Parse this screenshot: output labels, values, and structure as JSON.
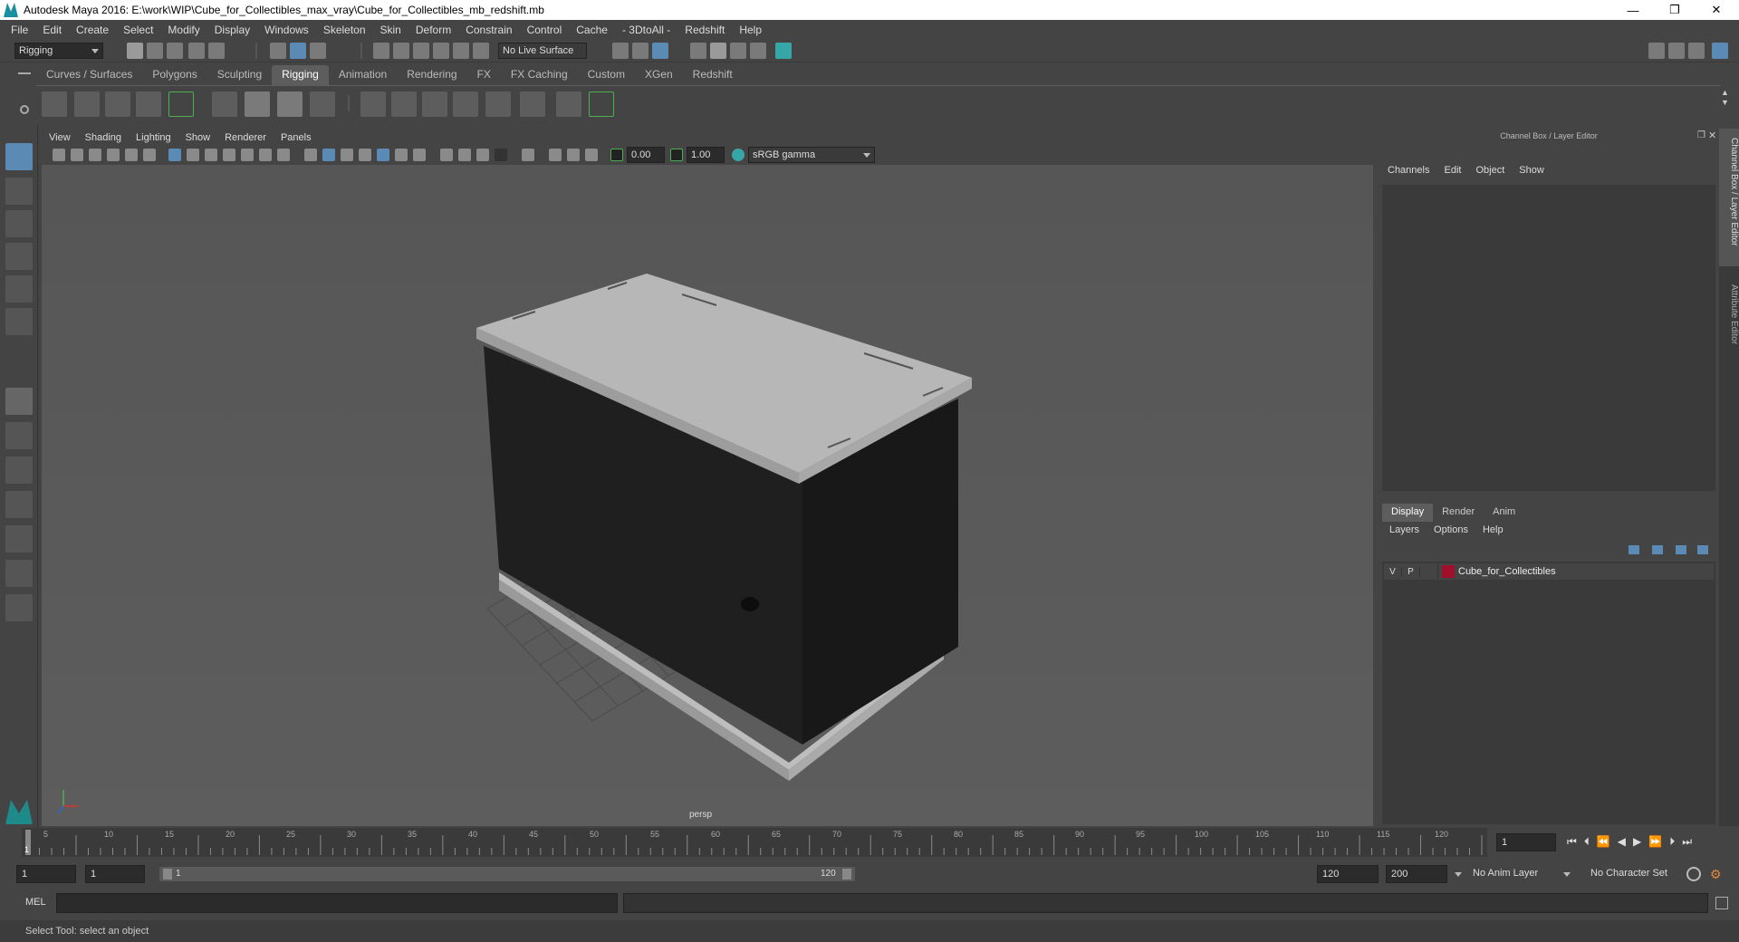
{
  "window": {
    "title": "Autodesk Maya 2016: E:\\work\\WIP\\Cube_for_Collectibles_max_vray\\Cube_for_Collectibles_mb_redshift.mb",
    "min": "—",
    "max": "❐",
    "close": "✕"
  },
  "menus": [
    "File",
    "Edit",
    "Create",
    "Select",
    "Modify",
    "Display",
    "Windows",
    "Skeleton",
    "Skin",
    "Deform",
    "Constrain",
    "Control",
    "Cache",
    "- 3DtoAll -",
    "Redshift",
    "Help"
  ],
  "statusline": {
    "menuset": "Rigging",
    "live_surface": "No Live Surface"
  },
  "shelf_tabs": [
    "Curves / Surfaces",
    "Polygons",
    "Sculpting",
    "Rigging",
    "Animation",
    "Rendering",
    "FX",
    "FX Caching",
    "Custom",
    "XGen",
    "Redshift"
  ],
  "shelf_active": "Rigging",
  "viewport": {
    "menus": [
      "View",
      "Shading",
      "Lighting",
      "Show",
      "Renderer",
      "Panels"
    ],
    "exposure": "0.00",
    "gamma": "1.00",
    "color_space": "sRGB gamma",
    "camera_label": "persp"
  },
  "channel_box": {
    "title": "Channel Box / Layer Editor",
    "menus": [
      "Channels",
      "Edit",
      "Object",
      "Show"
    ]
  },
  "layer_editor": {
    "tabs": [
      "Display",
      "Render",
      "Anim"
    ],
    "active_tab": "Display",
    "menus": [
      "Layers",
      "Options",
      "Help"
    ],
    "layers": [
      {
        "v": "V",
        "p": "P",
        "name": "Cube_for_Collectibles",
        "color": "#a0102a"
      }
    ]
  },
  "side_tabs": [
    "Channel Box / Layer Editor",
    "Attribute Editor"
  ],
  "timeline": {
    "ticks": [
      "5",
      "10",
      "15",
      "20",
      "25",
      "30",
      "35",
      "40",
      "45",
      "50",
      "55",
      "60",
      "65",
      "70",
      "75",
      "80",
      "85",
      "90",
      "95",
      "100",
      "105",
      "110",
      "115",
      "120"
    ],
    "start_label": "1",
    "current_frame": "1"
  },
  "range": {
    "start": "1",
    "playback_start": "1",
    "slider_start": "1",
    "slider_end": "120",
    "playback_end": "120",
    "end": "200",
    "anim_layer": "No Anim Layer",
    "character_set": "No Character Set"
  },
  "command": {
    "label": "MEL"
  },
  "help_line": "Select Tool: select an object"
}
